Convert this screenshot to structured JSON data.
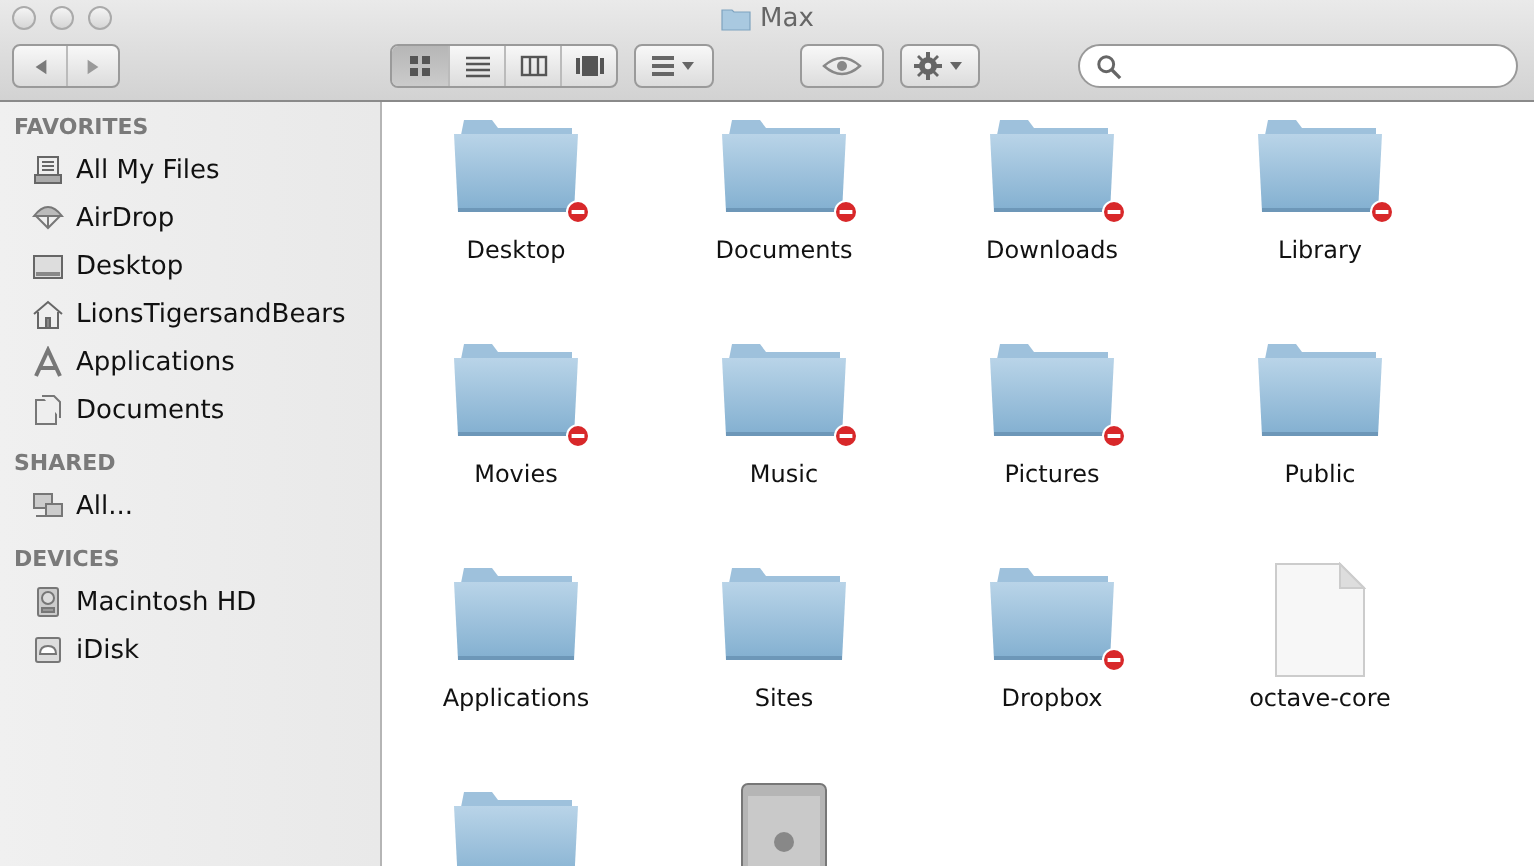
{
  "window": {
    "title": "Max"
  },
  "toolbar": {
    "view_modes": [
      {
        "kind": "icon",
        "selected": true
      },
      {
        "kind": "list",
        "selected": false
      },
      {
        "kind": "columns",
        "selected": false
      },
      {
        "kind": "coverflow",
        "selected": false
      }
    ]
  },
  "sidebar": {
    "sections": [
      {
        "title": "FAVORITES",
        "items": [
          {
            "label": "All My Files",
            "kind": "files"
          },
          {
            "label": "AirDrop",
            "kind": "airdrop"
          },
          {
            "label": "Desktop",
            "kind": "desktop"
          },
          {
            "label": "LionsTigersandBears",
            "kind": "home"
          },
          {
            "label": "Applications",
            "kind": "apps"
          },
          {
            "label": "Documents",
            "kind": "docs"
          }
        ]
      },
      {
        "title": "SHARED",
        "items": [
          {
            "label": "All...",
            "kind": "network"
          }
        ]
      },
      {
        "title": "DEVICES",
        "items": [
          {
            "label": "Macintosh HD",
            "kind": "disk"
          },
          {
            "label": "iDisk",
            "kind": "idisk"
          }
        ]
      }
    ]
  },
  "items": [
    {
      "label": "Desktop",
      "kind": "folder",
      "restricted": true
    },
    {
      "label": "Documents",
      "kind": "folder",
      "restricted": true
    },
    {
      "label": "Downloads",
      "kind": "folder",
      "restricted": true
    },
    {
      "label": "Library",
      "kind": "folder",
      "restricted": true
    },
    {
      "label": "Movies",
      "kind": "folder",
      "restricted": true
    },
    {
      "label": "Music",
      "kind": "folder",
      "restricted": true
    },
    {
      "label": "Pictures",
      "kind": "folder",
      "restricted": true
    },
    {
      "label": "Public",
      "kind": "folder",
      "restricted": false
    },
    {
      "label": "Applications",
      "kind": "folder",
      "restricted": false
    },
    {
      "label": "Sites",
      "kind": "folder",
      "restricted": false
    },
    {
      "label": "Dropbox",
      "kind": "folder",
      "restricted": true
    },
    {
      "label": "octave-core",
      "kind": "document",
      "restricted": false
    },
    {
      "kind": "folder",
      "restricted": false
    },
    {
      "kind": "computer",
      "restricted": false
    }
  ]
}
